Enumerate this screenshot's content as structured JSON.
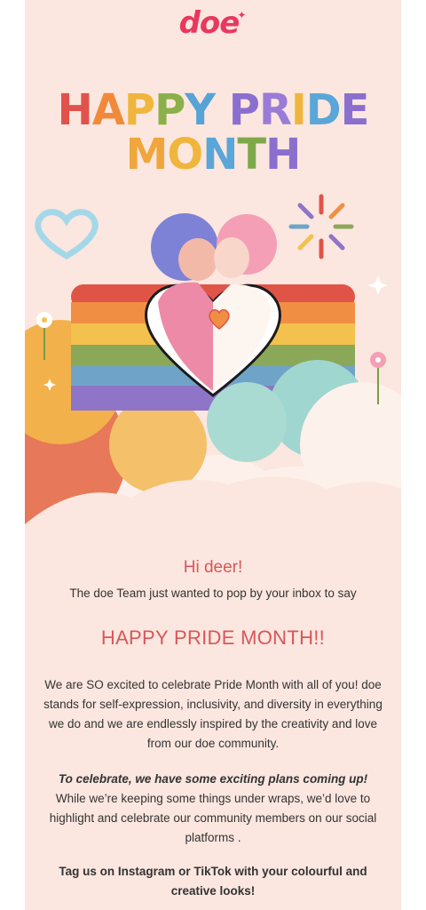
{
  "brand": {
    "logo_text": "doe",
    "logo_spark": "✦"
  },
  "headline": {
    "line1": [
      {
        "char": "H",
        "color": "#e0524b"
      },
      {
        "char": "A",
        "color": "#f08a3a"
      },
      {
        "char": "P",
        "color": "#f0b53c"
      },
      {
        "char": "P",
        "color": "#8bb04a"
      },
      {
        "char": "Y",
        "color": "#56a3d6"
      },
      {
        "char": " ",
        "color": "#000000"
      },
      {
        "char": "P",
        "color": "#8b6fcf"
      },
      {
        "char": "R",
        "color": "#9a7bd8"
      },
      {
        "char": "I",
        "color": "#f0b53c"
      },
      {
        "char": "D",
        "color": "#5aa6d8"
      },
      {
        "char": "E",
        "color": "#8b6fcf"
      }
    ],
    "line2": [
      {
        "char": "M",
        "color": "#f0a63c"
      },
      {
        "char": "O",
        "color": "#f0b53c"
      },
      {
        "char": "N",
        "color": "#5aa6d8"
      },
      {
        "char": "T",
        "color": "#7ea84a"
      },
      {
        "char": "H",
        "color": "#8b6fcf"
      }
    ]
  },
  "body": {
    "greeting": "Hi deer!",
    "intro": "The doe Team just wanted to pop by your inbox to say",
    "pride_title": "HAPPY PRIDE MONTH!!",
    "paragraph1": "We are SO excited to celebrate Pride Month with all of you! doe stands for self-expression, inclusivity, and diversity in everything we do and we are endlessly inspired by the creativity and love from our doe community.",
    "paragraph2_emph": "To celebrate, we have some exciting plans coming up!",
    "paragraph2_rest": " While we’re keeping some things under wraps, we’d love to highlight and celebrate our community members on our social platforms .",
    "paragraph3": "Tag us on Instagram or TikTok with your colourful and creative looks!"
  },
  "colors": {
    "background": "#fbe7df",
    "accent": "#e8385e",
    "title_red": "#d9565a"
  }
}
